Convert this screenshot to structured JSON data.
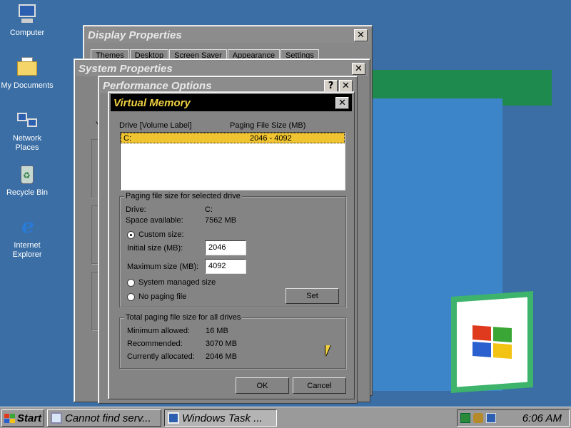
{
  "desktop": {
    "icons": [
      {
        "label": "Computer",
        "icon": "computer-icon"
      },
      {
        "label": "My Documents",
        "icon": "documents-icon"
      },
      {
        "label": "Network Places",
        "icon": "network-icon"
      },
      {
        "label": "Recycle Bin",
        "icon": "recycle-bin-icon"
      },
      {
        "label": "Internet Explorer",
        "icon": "internet-explorer-icon"
      }
    ]
  },
  "display_properties": {
    "title": "Display Properties",
    "tabs": [
      "Themes",
      "Desktop",
      "Screen Saver",
      "Appearance",
      "Settings"
    ]
  },
  "system_properties": {
    "title": "System Properties",
    "partial_text": "Y"
  },
  "performance_options": {
    "title": "Performance Options",
    "help_label": "?",
    "close_label": "✕"
  },
  "virtual_memory": {
    "title": "Virtual Memory",
    "close_label": "✕",
    "list": {
      "col_drive": "Drive  [Volume Label]",
      "col_size": "Paging File Size (MB)",
      "rows": [
        {
          "drive": "C:",
          "size": "2046 - 4092"
        }
      ]
    },
    "selected_group": {
      "title": "Paging file size for selected drive",
      "drive_label": "Drive:",
      "drive_value": "C:",
      "space_label": "Space available:",
      "space_value": "7562 MB",
      "custom_size_label": "Custom size:",
      "initial_label": "Initial size (MB):",
      "initial_value": "2046",
      "maximum_label": "Maximum size (MB):",
      "maximum_value": "4092",
      "system_managed_label": "System managed size",
      "no_paging_label": "No paging file",
      "set_label": "Set",
      "selected_option": "custom"
    },
    "total_group": {
      "title": "Total paging file size for all drives",
      "min_label": "Minimum allowed:",
      "min_value": "16 MB",
      "rec_label": "Recommended:",
      "rec_value": "3070 MB",
      "cur_label": "Currently allocated:",
      "cur_value": "2046 MB"
    },
    "ok_label": "OK",
    "cancel_label": "Cancel"
  },
  "taskbar": {
    "start_label": "Start",
    "tasks": [
      {
        "label": "Cannot find serv..."
      },
      {
        "label": "Windows Task ..."
      }
    ],
    "clock": "6:06 AM"
  },
  "colors": {
    "desktop": "#3a6ea5",
    "vm_title_bg": "#000000",
    "vm_title_fg": "#f0d040",
    "list_selection": "#f0c431"
  }
}
